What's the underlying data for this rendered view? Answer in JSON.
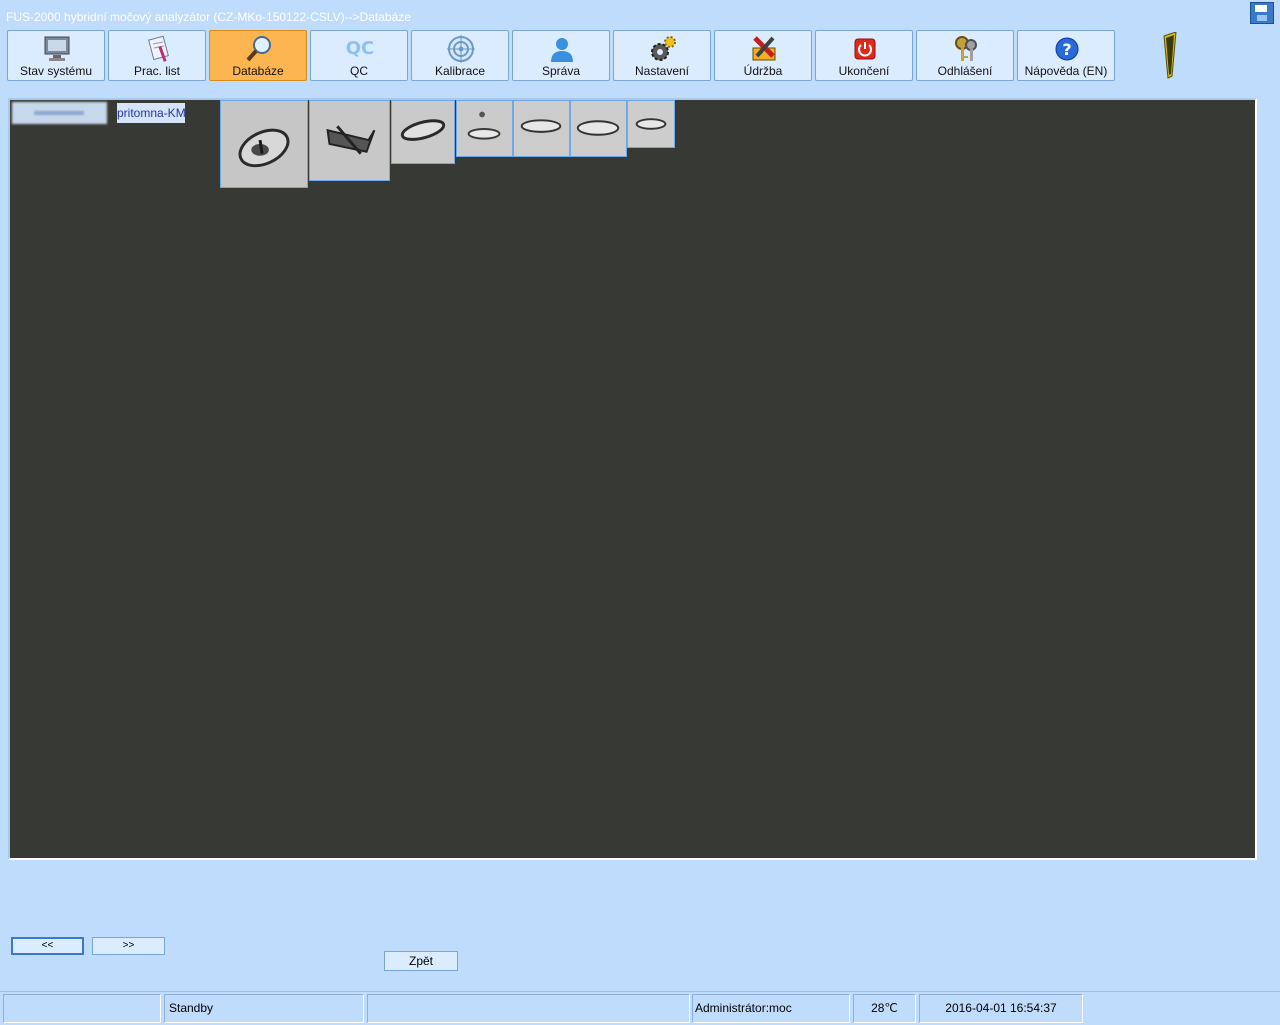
{
  "window": {
    "title": "FUS-2000 hybridní močový analyzátor (CZ-MKo-150122-CSLV)-->Databáze"
  },
  "toolbar": {
    "buttons": [
      {
        "label": "Stav systému",
        "icon": "monitor-icon"
      },
      {
        "label": "Prac. list",
        "icon": "worklist-icon"
      },
      {
        "label": "Databáze",
        "icon": "magnifier-icon",
        "active": true
      },
      {
        "label": "QC",
        "icon": "qc-icon",
        "icon_text": "QC"
      },
      {
        "label": "Kalibrace",
        "icon": "target-icon"
      },
      {
        "label": "Správa",
        "icon": "user-icon"
      },
      {
        "label": "Nastavení",
        "icon": "gears-icon"
      },
      {
        "label": "Údržba",
        "icon": "tools-icon"
      },
      {
        "label": "Ukončení",
        "icon": "power-icon"
      },
      {
        "label": "Odhlášení",
        "icon": "keys-icon"
      },
      {
        "label": "Nápověda (EN)",
        "icon": "help-icon",
        "icon_text": "?"
      }
    ],
    "active_color": "#fcb550"
  },
  "viewer": {
    "tag_label": "pritomna-KM",
    "thumbnails": [
      "crystal-image-1",
      "crystal-image-2",
      "crystal-image-3",
      "crystal-image-4",
      "crystal-image-5",
      "crystal-image-6",
      "crystal-image-7"
    ]
  },
  "navigation": {
    "prev_label": "<<",
    "next_label": ">>",
    "back_label": "Zpět"
  },
  "status": {
    "cell1": "",
    "state": "Standby",
    "cell3": "",
    "user": "Administrátor:moc",
    "temperature": "28℃",
    "datetime": "2016-04-01 16:54:37"
  },
  "colors": {
    "background": "#c0dcfc",
    "viewer_bg": "#373935"
  }
}
